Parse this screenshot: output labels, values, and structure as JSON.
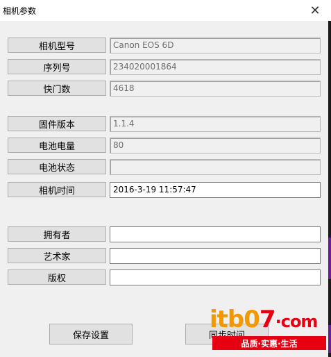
{
  "window": {
    "title": "相机参数",
    "close_glyph": "✕"
  },
  "fields": [
    {
      "label": "相机型号",
      "value": "Canon EOS 6D"
    },
    {
      "label": "序列号",
      "value": "234020001864"
    },
    {
      "label": "快门数",
      "value": "4618"
    },
    {
      "label": "固件版本",
      "value": "1.1.4"
    },
    {
      "label": "电池电量",
      "value": "80"
    },
    {
      "label": "电池状态",
      "value": ""
    },
    {
      "label": "相机时间",
      "value": "2016-3-19 11:57:47"
    },
    {
      "label": "拥有者",
      "value": ""
    },
    {
      "label": "艺术家",
      "value": ""
    },
    {
      "label": "版权",
      "value": ""
    }
  ],
  "buttons": {
    "save": "保存设置",
    "sync": "同步时间"
  },
  "watermark": {
    "logo_part1": "it",
    "logo_part2": "b0",
    "logo_part3": "7",
    "logo_part4": "·com",
    "slogan": "品质·实惠·生活"
  },
  "colors": {
    "window_bg": "#f0f0f0",
    "button_bg": "#e1e1e1",
    "watermark_orange": "#f39800",
    "watermark_red": "#e60012"
  }
}
